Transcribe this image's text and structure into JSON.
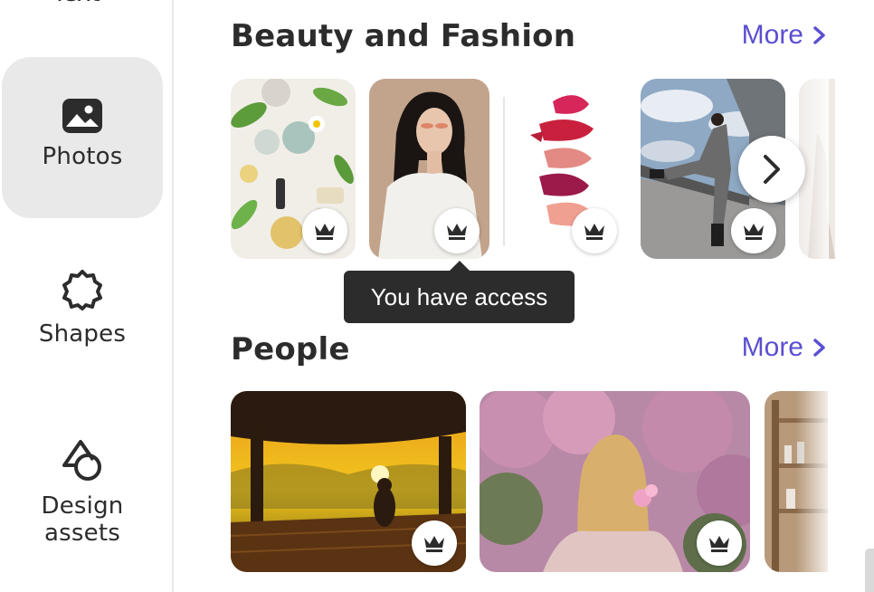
{
  "sidebar": {
    "partial_label": "Text",
    "items": [
      {
        "label": "Photos",
        "icon": "photo-icon",
        "active": true
      },
      {
        "label": "Shapes",
        "icon": "shape-icon",
        "active": false
      },
      {
        "label": "Design assets",
        "icon": "design-assets-icon",
        "active": false
      }
    ]
  },
  "sections": [
    {
      "title": "Beauty and Fashion",
      "more_label": "More",
      "thumbnails": [
        {
          "subject": "skincare-flatlay",
          "premium": true
        },
        {
          "subject": "woman-portrait",
          "premium": true
        },
        {
          "subject": "lipstick-swatches",
          "premium": true
        },
        {
          "subject": "fashion-model-bridge",
          "premium": true
        },
        {
          "subject": "partial",
          "premium": false
        }
      ]
    },
    {
      "title": "People",
      "more_label": "More",
      "thumbnails": [
        {
          "subject": "sunset-hut",
          "premium": true
        },
        {
          "subject": "woman-cherry-blossom",
          "premium": true
        },
        {
          "subject": "partial-shop",
          "premium": false
        }
      ]
    }
  ],
  "tooltip": {
    "text": "You have access"
  },
  "colors": {
    "accent": "#5a4fd1",
    "active_bg": "#e9e9e9",
    "tooltip_bg": "#2c2c2c",
    "text": "#2c2c2c"
  }
}
